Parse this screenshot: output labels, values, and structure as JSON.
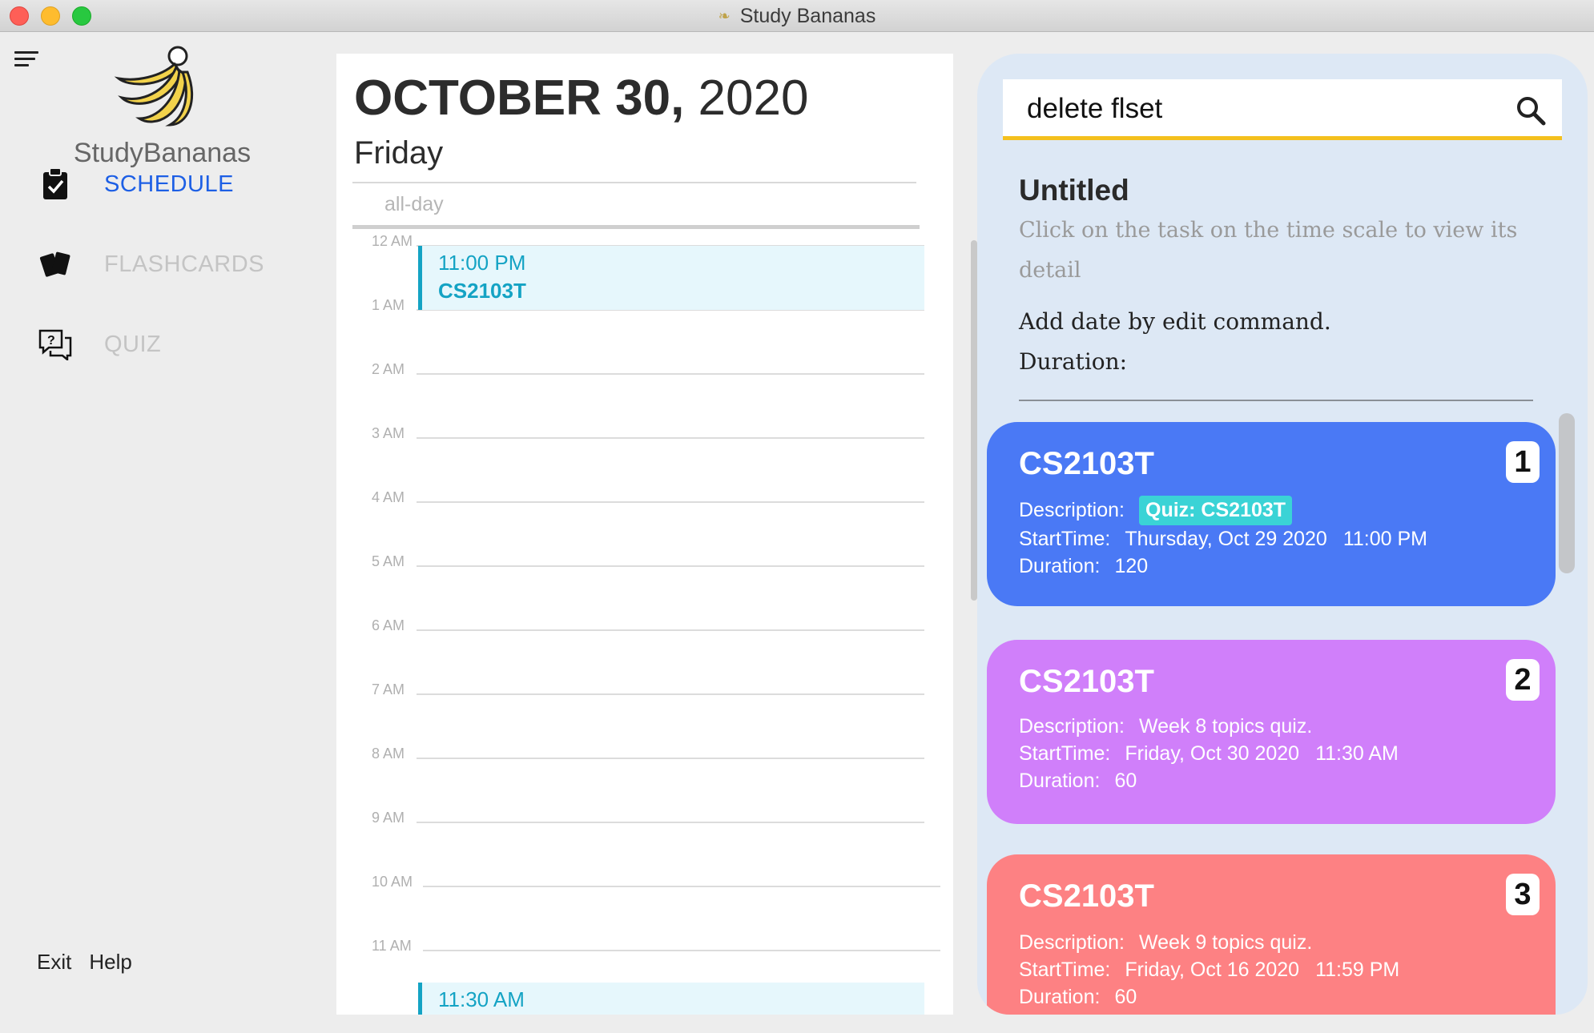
{
  "window": {
    "title": "Study Bananas"
  },
  "sidebar": {
    "brand": "StudyBananas",
    "nav": [
      {
        "label": "SCHEDULE",
        "icon": "clipboard-check-icon",
        "active": true
      },
      {
        "label": "FLASHCARDS",
        "icon": "flashcards-icon",
        "active": false
      },
      {
        "label": "QUIZ",
        "icon": "quiz-chat-icon",
        "active": false
      }
    ],
    "bottom": {
      "exit": "Exit",
      "help": "Help"
    }
  },
  "calendar": {
    "month_day": "OCTOBER 30,",
    "year": "2020",
    "weekday": "Friday",
    "allday_label": "all-day",
    "hours": [
      "12 AM",
      "1 AM",
      "2 AM",
      "3 AM",
      "4 AM",
      "5 AM",
      "6 AM",
      "7 AM",
      "8 AM",
      "9 AM",
      "10 AM",
      "11 AM"
    ],
    "events": [
      {
        "time": "11:00 PM",
        "title": "CS2103T"
      },
      {
        "time": "11:30 AM",
        "title": ""
      }
    ]
  },
  "search": {
    "value": "delete flset"
  },
  "detail": {
    "title": "Untitled",
    "hint": "Click on the task on the time scale to view its detail",
    "add_date": "Add date by edit command.",
    "duration_label": "Duration:"
  },
  "labels": {
    "description": "Description:",
    "starttime": "StartTime:",
    "duration": "Duration:"
  },
  "tasks": [
    {
      "index": "1",
      "title": "CS2103T",
      "description": "Quiz: CS2103T",
      "start_date": "Thursday, Oct 29 2020",
      "start_time": "11:00 PM",
      "duration": "120",
      "color": "#4a79f5"
    },
    {
      "index": "2",
      "title": "CS2103T",
      "description": "Week 8 topics quiz.",
      "start_date": "Friday, Oct 30 2020",
      "start_time": "11:30 AM",
      "duration": "60",
      "color": "#d07ffa"
    },
    {
      "index": "3",
      "title": "CS2103T",
      "description": "Week 9 topics quiz.",
      "start_date": "Friday, Oct 16 2020",
      "start_time": "11:59 PM",
      "duration": "60",
      "color": "#fd8183"
    }
  ],
  "colors": {
    "accent_blue": "#1d5fe5",
    "event_teal": "#14a3c4",
    "search_underline": "#f4c01e",
    "tag_teal": "#3ad3d6"
  }
}
